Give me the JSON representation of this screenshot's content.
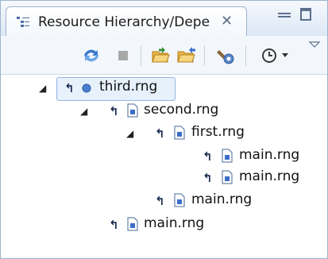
{
  "view": {
    "title": "Resource Hierarchy/Depe",
    "close_glyph": "✕"
  },
  "toolbar": {
    "buttons": [
      {
        "name": "refresh-icon"
      },
      {
        "name": "stop-icon"
      },
      {
        "name": "open-folder-icon"
      },
      {
        "name": "open-folder-alt-icon"
      },
      {
        "name": "configure-icon"
      },
      {
        "name": "history-icon"
      }
    ]
  },
  "tree": {
    "root": "third.rng",
    "n1": "second.rng",
    "n2": "first.rng",
    "n3": "main.rng",
    "n4": "main.rng",
    "n5": "main.rng",
    "n6": "main.rng"
  }
}
